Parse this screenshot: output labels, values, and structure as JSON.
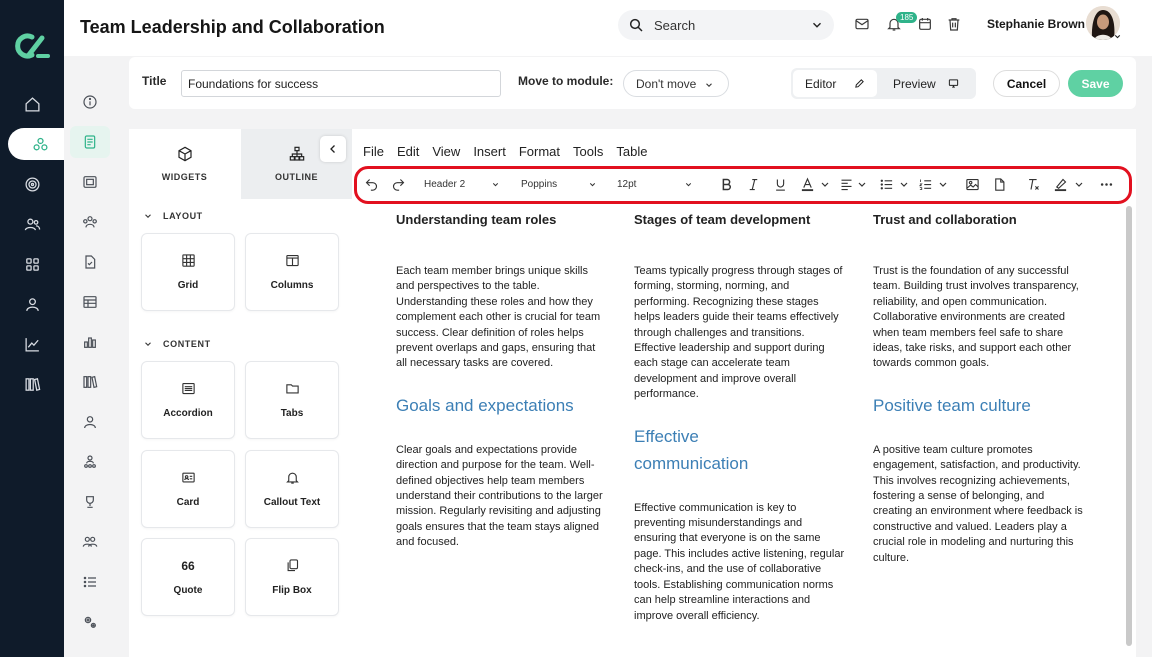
{
  "header": {
    "title": "Team Leadership and Collaboration",
    "search_placeholder": "Search",
    "notification_count": "185",
    "user_name": "Stephanie Brown"
  },
  "topbar": {
    "title_label": "Title",
    "title_value": "Foundations for success",
    "move_label": "Move to module:",
    "move_value": "Don't move",
    "editor_label": "Editor",
    "preview_label": "Preview",
    "cancel_label": "Cancel",
    "save_label": "Save"
  },
  "panel": {
    "tabs": [
      {
        "label": "WIDGETS"
      },
      {
        "label": "OUTLINE"
      }
    ],
    "sections": {
      "layout": "LAYOUT",
      "content": "CONTENT"
    },
    "layout_widgets": [
      {
        "label": "Grid"
      },
      {
        "label": "Columns"
      }
    ],
    "content_widgets": [
      {
        "label": "Accordion"
      },
      {
        "label": "Tabs"
      },
      {
        "label": "Card"
      },
      {
        "label": "Callout Text"
      },
      {
        "label": "Quote"
      },
      {
        "label": "Flip Box"
      }
    ],
    "quote_glyph": "66"
  },
  "editor": {
    "menu": [
      "File",
      "Edit",
      "View",
      "Insert",
      "Format",
      "Tools",
      "Table"
    ],
    "block_format": "Header 2",
    "font_family": "Poppins",
    "font_size": "12pt"
  },
  "content": {
    "columns": [
      {
        "heading": "Understanding team roles",
        "body": "Each team member brings unique skills and perspectives to the table. Understanding these roles and how they complement each other is crucial for team success. Clear definition of roles helps prevent overlaps and gaps, ensuring that all necessary tasks are covered.",
        "subheading": "Goals and expectations",
        "body2": "Clear goals and expectations provide direction and purpose for the team. Well-defined objectives help team members understand their contributions to the larger mission. Regularly revisiting and adjusting goals ensures that the team stays aligned and focused."
      },
      {
        "heading": "Stages of team development",
        "body": "Teams typically progress through stages of forming, storming, norming, and performing. Recognizing these stages helps leaders guide their teams effectively through challenges and transitions. Effective leadership and support during each stage can accelerate team development and improve overall performance.",
        "subheading": "Effective communication",
        "body2": "Effective communication is key to preventing misunderstandings and ensuring that everyone is on the same page. This includes active listening, regular check-ins, and the use of collaborative tools. Establishing communication norms can help streamline interactions and improve overall efficiency."
      },
      {
        "heading": "Trust and collaboration",
        "body": "Trust is the foundation of any successful team. Building trust involves transparency, reliability, and open communication. Collaborative environments are created when team members feel safe to share ideas, take risks, and support each other towards common goals.",
        "subheading": "Positive team culture",
        "body2": "A positive team culture promotes engagement, satisfaction, and productivity. This involves recognizing achievements, fostering a sense of belonging, and creating an environment where feedback is constructive and valued. Leaders play a crucial role in modeling and nurturing this culture."
      }
    ]
  },
  "colors": {
    "accent": "#2fb38a",
    "save": "#5fd1a3",
    "nav_bg": "#0f1b2a",
    "heading_blue": "#3c7fb5",
    "highlight_red": "#e2101f"
  }
}
